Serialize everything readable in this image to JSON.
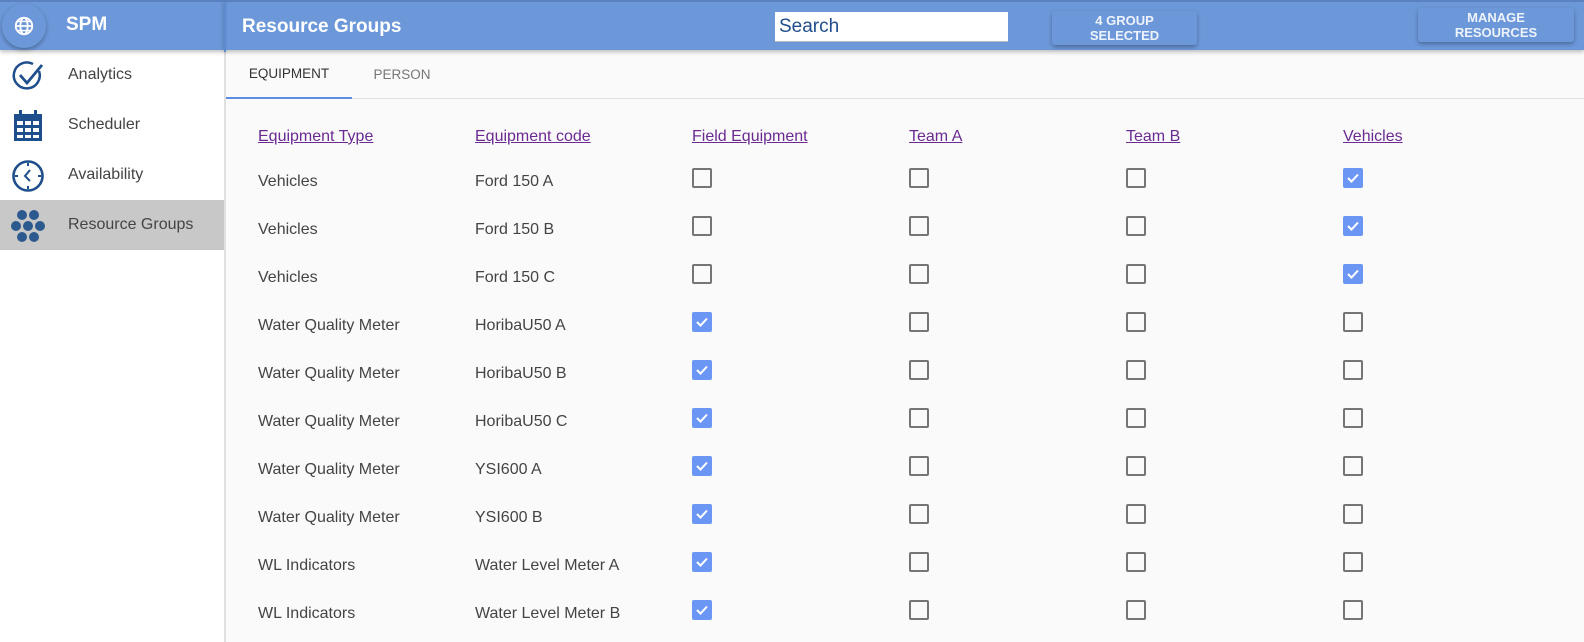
{
  "app": {
    "brand": "SPM",
    "brand_icon": "globe-icon"
  },
  "header": {
    "title": "Resource Groups",
    "search_placeholder": "Search",
    "search_value": "",
    "groups_selected_label": "4 GROUP SELECTED",
    "manage_resources_label": "MANAGE RESOURCES"
  },
  "sidebar": {
    "items": [
      {
        "label": "Analytics",
        "icon": "check-circle-icon",
        "active": false
      },
      {
        "label": "Scheduler",
        "icon": "calendar-icon",
        "active": false
      },
      {
        "label": "Availability",
        "icon": "clock-icon",
        "active": false
      },
      {
        "label": "Resource Groups",
        "icon": "hexagon-cluster-icon",
        "active": true
      }
    ]
  },
  "tabs": [
    {
      "label": "EQUIPMENT",
      "active": true
    },
    {
      "label": "PERSON",
      "active": false
    }
  ],
  "table": {
    "columns": [
      "Equipment Type",
      "Equipment code",
      "Field Equipment",
      "Team A",
      "Team B",
      "Vehicles"
    ],
    "rows": [
      {
        "type": "Vehicles",
        "code": "Ford 150 A",
        "groups": [
          false,
          false,
          false,
          true
        ]
      },
      {
        "type": "Vehicles",
        "code": "Ford 150 B",
        "groups": [
          false,
          false,
          false,
          true
        ]
      },
      {
        "type": "Vehicles",
        "code": "Ford 150 C",
        "groups": [
          false,
          false,
          false,
          true
        ]
      },
      {
        "type": "Water Quality Meter",
        "code": "HoribaU50 A",
        "groups": [
          true,
          false,
          false,
          false
        ]
      },
      {
        "type": "Water Quality Meter",
        "code": "HoribaU50 B",
        "groups": [
          true,
          false,
          false,
          false
        ]
      },
      {
        "type": "Water Quality Meter",
        "code": "HoribaU50 C",
        "groups": [
          true,
          false,
          false,
          false
        ]
      },
      {
        "type": "Water Quality Meter",
        "code": "YSI600 A",
        "groups": [
          true,
          false,
          false,
          false
        ]
      },
      {
        "type": "Water Quality Meter",
        "code": "YSI600 B",
        "groups": [
          true,
          false,
          false,
          false
        ]
      },
      {
        "type": "WL Indicators",
        "code": "Water Level Meter A",
        "groups": [
          true,
          false,
          false,
          false
        ]
      },
      {
        "type": "WL Indicators",
        "code": "Water Level Meter B",
        "groups": [
          true,
          false,
          false,
          false
        ]
      }
    ]
  },
  "colors": {
    "header": "#6c98da",
    "accent": "#6b96f4",
    "link": "#6a2a92",
    "icon": "#1f4e8c"
  }
}
